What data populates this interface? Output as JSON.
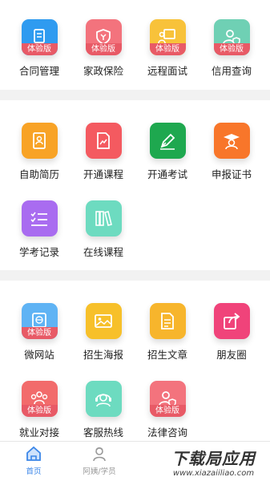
{
  "colors": {
    "blue": "#2f9bf0",
    "pink": "#f3737d",
    "yellow": "#f8c23a",
    "mint": "#6fd0b4",
    "orange": "#f8a326",
    "red": "#f45a60",
    "green": "#1ea84f",
    "purple": "#a96cf0",
    "teal": "#6ddbc0",
    "amber": "#f7b52c",
    "magenta": "#f0437a",
    "lightblue": "#5fb3f4",
    "rose": "#f26b6b",
    "trial_ribbon": "#e85a66",
    "tab_active": "#3b86e8",
    "tab_inactive": "#999999"
  },
  "trial_label": "体验版",
  "section1": {
    "items": [
      {
        "label": "合同管理",
        "icon": "document-icon",
        "trial": true
      },
      {
        "label": "家政保险",
        "icon": "shield-icon",
        "trial": true
      },
      {
        "label": "远程面试",
        "icon": "presenter-icon",
        "trial": true
      },
      {
        "label": "信用查询",
        "icon": "user-shield-icon",
        "trial": true
      }
    ]
  },
  "section2": {
    "items": [
      {
        "label": "自助简历",
        "icon": "resume-icon",
        "trial": false
      },
      {
        "label": "开通课程",
        "icon": "chart-doc-icon",
        "trial": false
      },
      {
        "label": "开通考试",
        "icon": "pen-icon",
        "trial": false
      },
      {
        "label": "申报证书",
        "icon": "graduate-icon",
        "trial": false
      },
      {
        "label": "学考记录",
        "icon": "checklist-icon",
        "trial": false
      },
      {
        "label": "在线课程",
        "icon": "books-icon",
        "trial": false
      }
    ]
  },
  "section3": {
    "items": [
      {
        "label": "微网站",
        "icon": "globe-icon",
        "trial": true
      },
      {
        "label": "招生海报",
        "icon": "picture-icon",
        "trial": false
      },
      {
        "label": "招生文章",
        "icon": "article-icon",
        "trial": false
      },
      {
        "label": "朋友圈",
        "icon": "share-icon",
        "trial": false
      },
      {
        "label": "就业对接",
        "icon": "team-icon",
        "trial": true
      },
      {
        "label": "客服热线",
        "icon": "headset-icon",
        "trial": false
      },
      {
        "label": "法律咨询",
        "icon": "lawyer-icon",
        "trial": true
      }
    ]
  },
  "tabbar": {
    "tabs": [
      {
        "label": "首页",
        "icon": "home-icon",
        "active": true
      },
      {
        "label": "阿姨/学员",
        "icon": "person-icon",
        "active": false
      }
    ]
  },
  "watermark": {
    "main": "下载局应用",
    "url": "www.xiazaiiliao.com"
  }
}
